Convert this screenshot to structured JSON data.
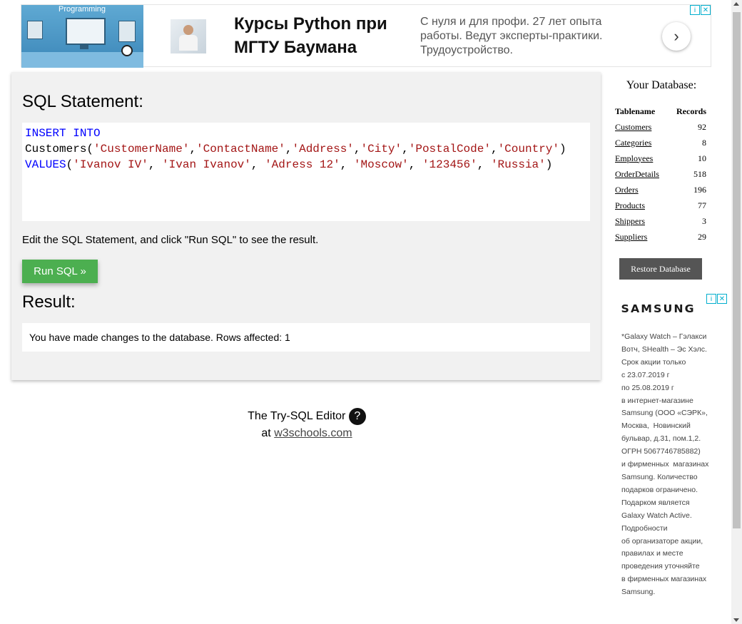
{
  "top_ad": {
    "image_label": "Programming",
    "title": "Курсы Python при МГТУ Баумана",
    "description": "С нуля и для профи. 27 лет опыта работы. Ведут эксперты-практики. Трудоустройство.",
    "arrow_icon": "chevron-right-icon"
  },
  "editor": {
    "sql_heading": "SQL Statement:",
    "code": {
      "line1_kw": "INSERT INTO",
      "line2_plain": "Customers(",
      "columns": [
        "'CustomerName'",
        "'ContactName'",
        "'Address'",
        "'City'",
        "'PostalCode'",
        "'Country'"
      ],
      "line3_kw": "VALUES",
      "values": [
        "'Ivanov IV'",
        "'Ivan Ivanov'",
        "'Adress 12'",
        "'Moscow'",
        "'123456'",
        "'Russia'"
      ]
    },
    "hint": "Edit the SQL Statement, and click \"Run SQL\" to see the result.",
    "run_label": "Run SQL »",
    "result_heading": "Result:",
    "result_text": "You have made changes to the database. Rows affected: 1"
  },
  "footer": {
    "line1": "The Try-SQL Editor",
    "help_symbol": "?",
    "at": "at",
    "link": "w3schools.com"
  },
  "sidebar": {
    "title": "Your Database:",
    "col_table": "Tablename",
    "col_records": "Records",
    "tables": [
      {
        "name": "Customers",
        "records": "92"
      },
      {
        "name": "Categories",
        "records": "8"
      },
      {
        "name": "Employees",
        "records": "10"
      },
      {
        "name": "OrderDetails",
        "records": "518"
      },
      {
        "name": "Orders",
        "records": "196"
      },
      {
        "name": "Products",
        "records": "77"
      },
      {
        "name": "Shippers",
        "records": "3"
      },
      {
        "name": "Suppliers",
        "records": "29"
      }
    ],
    "restore_label": "Restore Database"
  },
  "side_ad": {
    "brand": "SAMSUNG",
    "text": "*Galaxy Watch – Гэлакси\nВотч, SHealth – Эс Хэлс.\nСрок акции только\nс 23.07.2019 г\nпо 25.08.2019 г\nв интернет-магазине\nSamsung (ООО «СЭРК»,\nМосква,  Новинский\nбульвар, д.31, пом.1,2.\nОГРН 5067746785882)\nи фирменных  магазинах\nSamsung. Количество\nподарков ограничено.\nПодарком является\nGalaxy Watch Active.\nПодробности\nоб организаторе акции,\nправилах и месте\nпроведения уточняйте\nв фирменных магазинах\nSamsung."
  },
  "colors": {
    "keyword": "#0000ff",
    "string": "#a31515",
    "run_button": "#4caf50",
    "restore_button": "#555555"
  }
}
